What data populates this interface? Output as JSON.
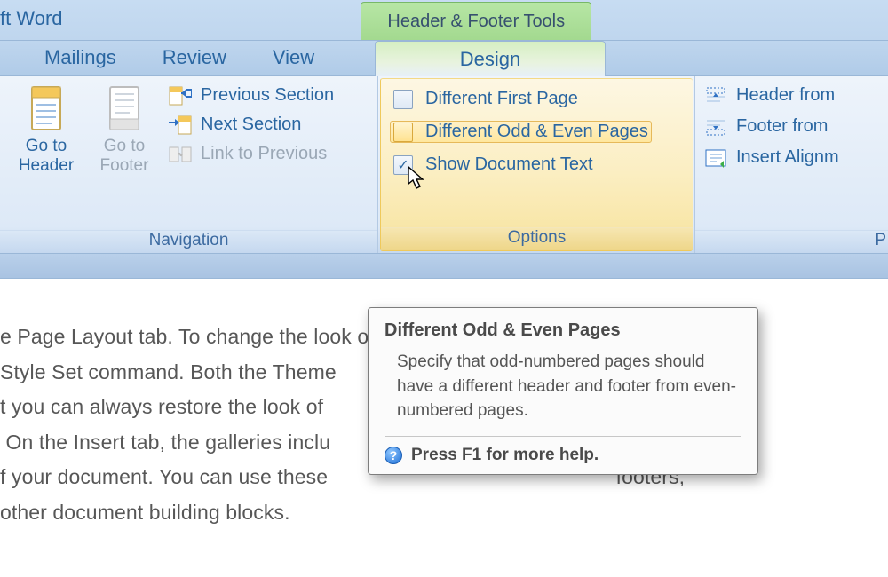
{
  "title": {
    "app_name_fragment": "ft Word",
    "contextual_tab_group": "Header & Footer Tools"
  },
  "tabs": {
    "mailings": "Mailings",
    "review": "Review",
    "view": "View",
    "design": "Design"
  },
  "ribbon": {
    "navigation": {
      "caption": "Navigation",
      "go_to_header": "Go to\nHeader",
      "go_to_footer": "Go to\nFooter",
      "previous_section": "Previous Section",
      "next_section": "Next Section",
      "link_to_previous": "Link to Previous"
    },
    "options": {
      "caption": "Options",
      "different_first_page": "Different First Page",
      "different_odd_even": "Different Odd & Even Pages",
      "show_document_text": "Show Document Text",
      "states": {
        "different_first_page": false,
        "different_odd_even": false,
        "show_document_text": true
      }
    },
    "position": {
      "caption_fragment": "P",
      "header_from": "Header from",
      "footer_from": "Footer from",
      "insert_alignment": "Insert Alignm"
    }
  },
  "tooltip": {
    "title": "Different Odd & Even Pages",
    "body": "Specify that odd-numbered pages should have a different header and footer from even-numbered pages.",
    "help": "Press F1 for more help."
  },
  "document_lines": [
    "e Page Layout tab. To change the look of                                        ery, use the",
    "Style Set command. Both the Theme                                                   ry provide",
    "t you can always restore the look of                                                  tained in",
    " On the Insert tab, the galleries inclu                                                 dinate",
    "f your document. You can use these                                                  footers,",
    "other document building blocks."
  ]
}
